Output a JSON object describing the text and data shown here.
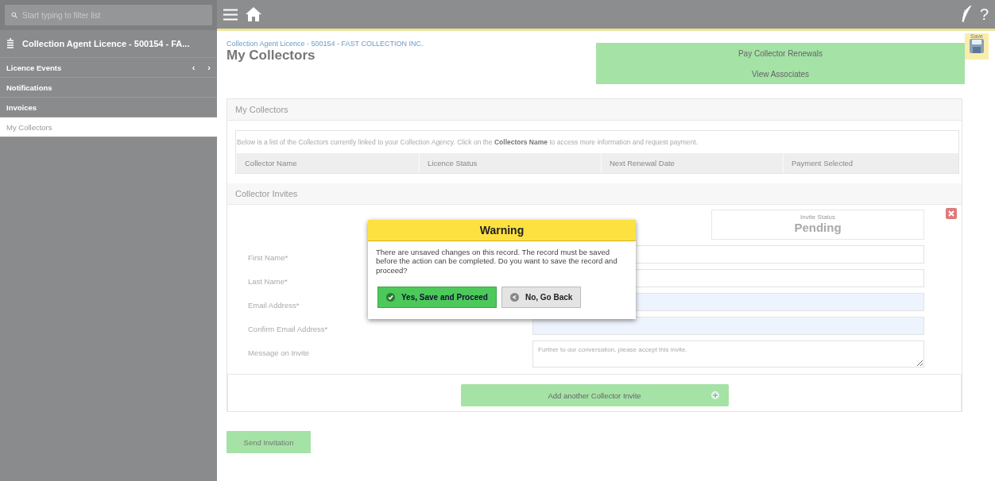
{
  "sidebar": {
    "search": {
      "placeholder": "Start typing to filter list"
    },
    "record_title": "Collection Agent Licence - 500154 - FA...",
    "items": [
      {
        "label": "Licence Events",
        "prev": "‹",
        "next": "›",
        "selected": false
      },
      {
        "label": "Notifications",
        "selected": false
      },
      {
        "label": "Invoices",
        "selected": false
      },
      {
        "label": "My Collectors",
        "selected": true
      }
    ]
  },
  "toolbar": {
    "help": "?"
  },
  "save": {
    "label": "Save"
  },
  "breadcrumb": "Collection Agent Licence - 500154 - FAST COLLECTION INC.",
  "page_title": "My Collectors",
  "actions": [
    "Pay Collector Renewals",
    "View Associates"
  ],
  "collectors": {
    "title": "My Collectors",
    "intro": "Below is a list of the Collectors currently linked to your Collection Agency. Click on the **Collectors Name** to access more information and request payment.",
    "columns": [
      "Collector Name",
      "Licence Status",
      "Next Renewal Date",
      "Payment Selected"
    ]
  },
  "invites": {
    "title": "Collector Invites",
    "status_label": "Invite Status",
    "status": "Pending",
    "fields": [
      {
        "label": "First Name*",
        "kind": "text",
        "highlighted": false
      },
      {
        "label": "Last Name*",
        "kind": "text",
        "highlighted": false
      },
      {
        "label": "Email Address*",
        "kind": "text",
        "highlighted": true
      },
      {
        "label": "Confirm Email Address*",
        "kind": "text",
        "highlighted": true
      },
      {
        "label": "Message on Invite",
        "kind": "textarea",
        "value": "Further to our conversation, please accept this invite.",
        "highlighted": false
      }
    ],
    "add_button": "Add another Collector Invite"
  },
  "send_button": "Send Invitation",
  "dialog": {
    "title": "Warning",
    "message": "There are unsaved changes on this record. The record must be saved before the action can be completed. Do you want to save the record and proceed?",
    "buttons": [
      {
        "label": "Yes, Save and Proceed",
        "kind": "primary"
      },
      {
        "label": "No, Go Back",
        "kind": "secondary"
      }
    ]
  }
}
